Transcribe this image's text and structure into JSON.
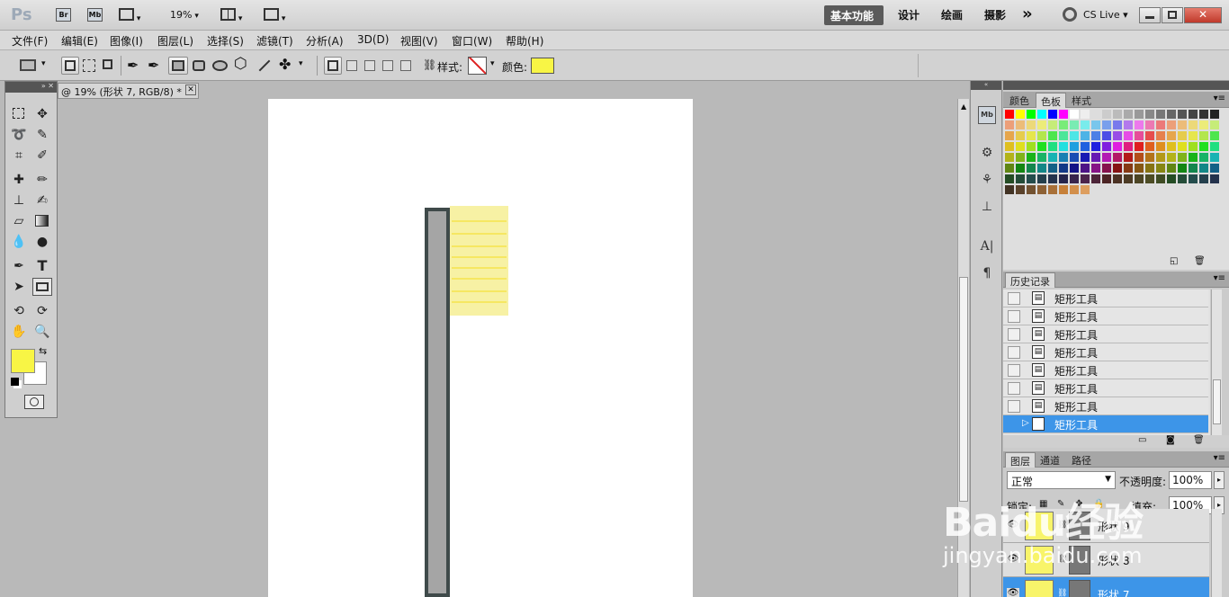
{
  "app": {
    "logo": "Ps",
    "zoom": "19%"
  },
  "launchers": [
    "Br",
    "Mb"
  ],
  "workspaces": {
    "active": "基本功能",
    "items": [
      "设计",
      "绘画",
      "摄影"
    ],
    "more": "»",
    "cslive": "CS Live"
  },
  "menu": [
    "文件(F)",
    "编辑(E)",
    "图像(I)",
    "图层(L)",
    "选择(S)",
    "滤镜(T)",
    "分析(A)",
    "3D(D)",
    "视图(V)",
    "窗口(W)",
    "帮助(H)"
  ],
  "options": {
    "style_label": "样式:",
    "color_label": "颜色:",
    "color_value": "#f8f545"
  },
  "document": {
    "tab_title": "@ 19% (形状 7, RGB/8) *",
    "close": "✕"
  },
  "colors": {
    "foreground": "#f8f545",
    "background": "#ffffff",
    "stem": "#a5a5a5",
    "stem_border": "#3f4a4a",
    "flag": "#f7f1a0",
    "flag_lines": "#f6e65a"
  },
  "swatches_panel": {
    "tabs": [
      "颜色",
      "色板",
      "样式"
    ],
    "active_tab": "色板"
  },
  "history_panel": {
    "title": "历史记录",
    "rows": [
      {
        "label": "矩形工具",
        "selected": false
      },
      {
        "label": "矩形工具",
        "selected": false
      },
      {
        "label": "矩形工具",
        "selected": false
      },
      {
        "label": "矩形工具",
        "selected": false
      },
      {
        "label": "矩形工具",
        "selected": false
      },
      {
        "label": "矩形工具",
        "selected": false
      },
      {
        "label": "矩形工具",
        "selected": false
      },
      {
        "label": "矩形工具",
        "selected": true
      }
    ]
  },
  "layers_panel": {
    "tabs": [
      "图层",
      "通道",
      "路径"
    ],
    "blend_mode": "正常",
    "opacity_label": "不透明度:",
    "opacity": "100%",
    "lock_label": "锁定:",
    "fill_label": "填充:",
    "fill": "100%",
    "layers": [
      {
        "name": "形状 9",
        "selected": false
      },
      {
        "name": "形状 8",
        "selected": false
      },
      {
        "name": "形状 7",
        "selected": true
      }
    ]
  },
  "watermark": {
    "line1": "Baidu经验",
    "line2": "jingyan.baidu.com"
  }
}
